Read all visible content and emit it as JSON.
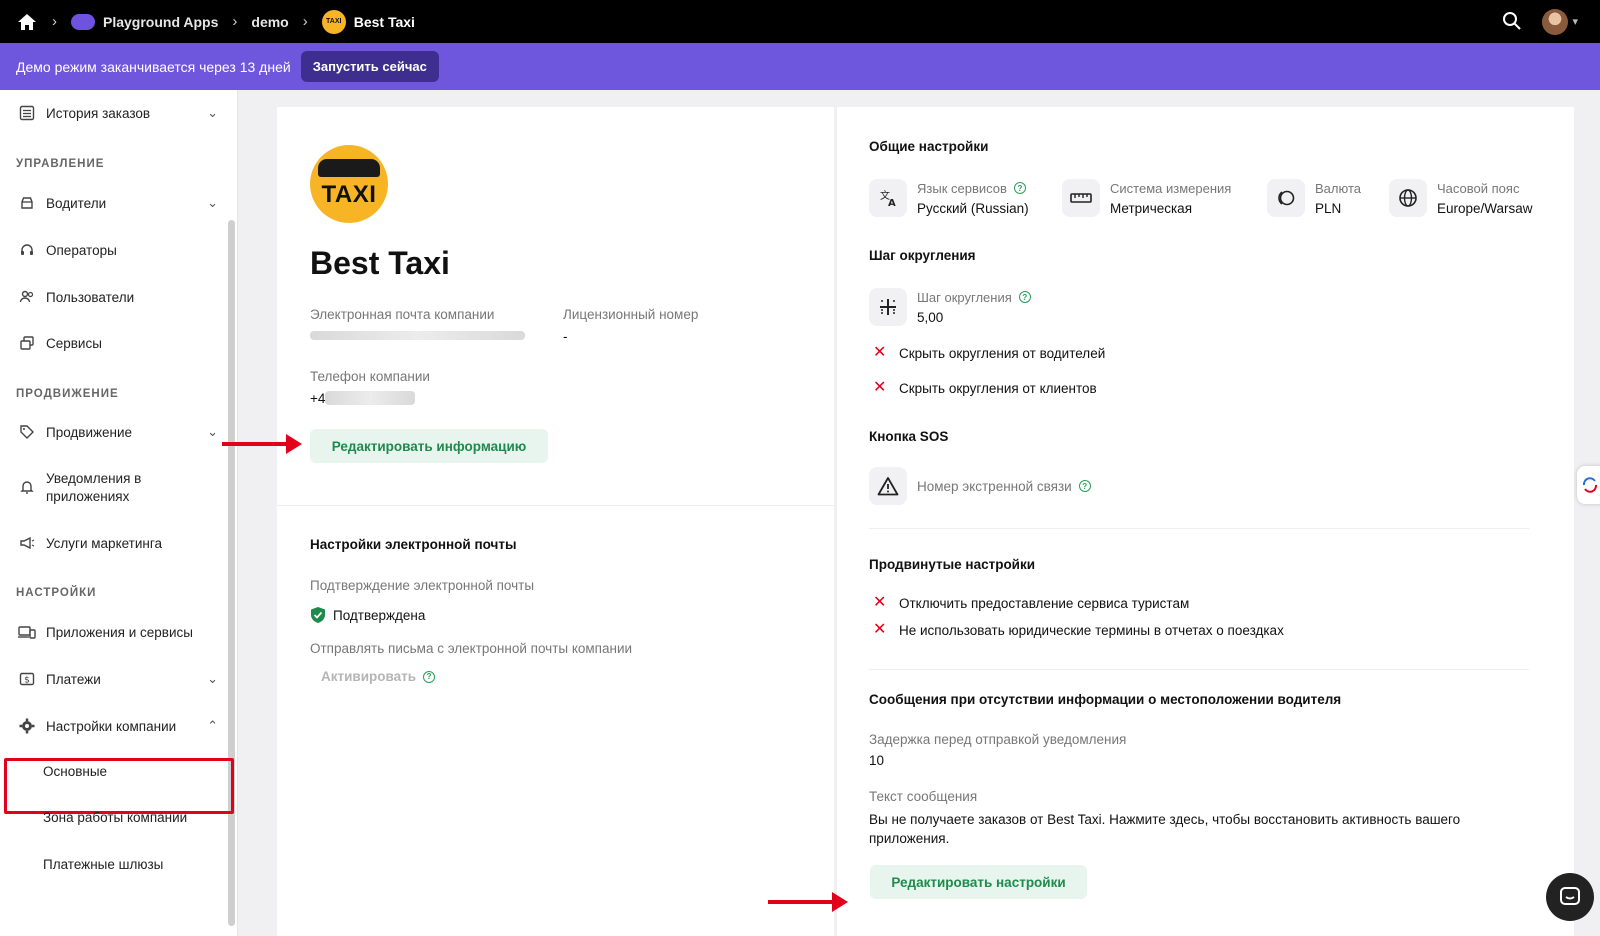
{
  "topbar": {
    "breadcrumbs": [
      "Playground Apps",
      "demo",
      "Best Taxi"
    ],
    "taxi_mini_text": "TAXI"
  },
  "banner": {
    "text": "Демо режим заканчивается через 13 дней",
    "button": "Запустить сейчас"
  },
  "sidebar": {
    "order_history": "История заказов",
    "sections": {
      "management": "УПРАВЛЕНИЕ",
      "promotion": "ПРОДВИЖЕНИЕ",
      "settings": "НАСТРОЙКИ"
    },
    "drivers": "Водители",
    "operators": "Операторы",
    "users": "Пользователи",
    "services": "Сервисы",
    "promo": "Продвижение",
    "notifications_line1": "Уведомления в",
    "notifications_line2": "приложениях",
    "marketing": "Услуги маркетинга",
    "apps_services": "Приложения и сервисы",
    "payments": "Платежи",
    "company_settings": "Настройки компании",
    "sub_main": "Основные",
    "sub_zone": "Зона работы компании",
    "sub_gateways": "Платежные шлюзы"
  },
  "company": {
    "logo_text": "TAXI",
    "name": "Best Taxi",
    "email_label": "Электронная почта компании",
    "license_label": "Лицензионный номер",
    "license_value": "-",
    "phone_label": "Телефон компании",
    "phone_value_prefix": "+4",
    "edit_info_button": "Редактировать информацию",
    "email_settings_title": "Настройки электронной почты",
    "email_confirm_label": "Подтверждение электронной почты",
    "email_confirm_value": "Подтверждена",
    "send_from_label": "Отправлять письма с электронной почты компании",
    "activate_button": "Активировать",
    "help_glyph": "?"
  },
  "settings": {
    "general_title": "Общие настройки",
    "language_label": "Язык сервисов",
    "language_value": "Русский (Russian)",
    "measure_label": "Система измерения",
    "measure_value": "Метрическая",
    "currency_label": "Валюта",
    "currency_value": "PLN",
    "timezone_label": "Часовой пояс",
    "timezone_value": "Europe/Warsaw",
    "rounding_title": "Шаг округления",
    "rounding_label": "Шаг округления",
    "rounding_value": "5,00",
    "hide_drivers": "Скрыть округления от водителей",
    "hide_clients": "Скрыть округления от клиентов",
    "sos_title": "Кнопка SOS",
    "sos_label": "Номер экстренной связи",
    "advanced_title": "Продвинутые настройки",
    "no_tourists": "Отключить предоставление сервиса туристам",
    "no_legal": "Не использовать юридические термины в отчетах о поездках",
    "location_title": "Сообщения при отсутствии информации о местоположении водителя",
    "delay_label": "Задержка перед отправкой уведомления",
    "delay_value": "10",
    "message_label": "Текст сообщения",
    "message_line1": "Вы не получаете заказов от Best Taxi. Нажмите здесь, чтобы восстановить активность вашего",
    "message_line2": "приложения.",
    "edit_settings_button": "Редактировать настройки",
    "x_glyph": "✕",
    "help_glyph": "?"
  },
  "colors": {
    "accent_green": "#1e8a4c",
    "banner_purple": "#6e57dc",
    "annotation_red": "#e3001b"
  }
}
